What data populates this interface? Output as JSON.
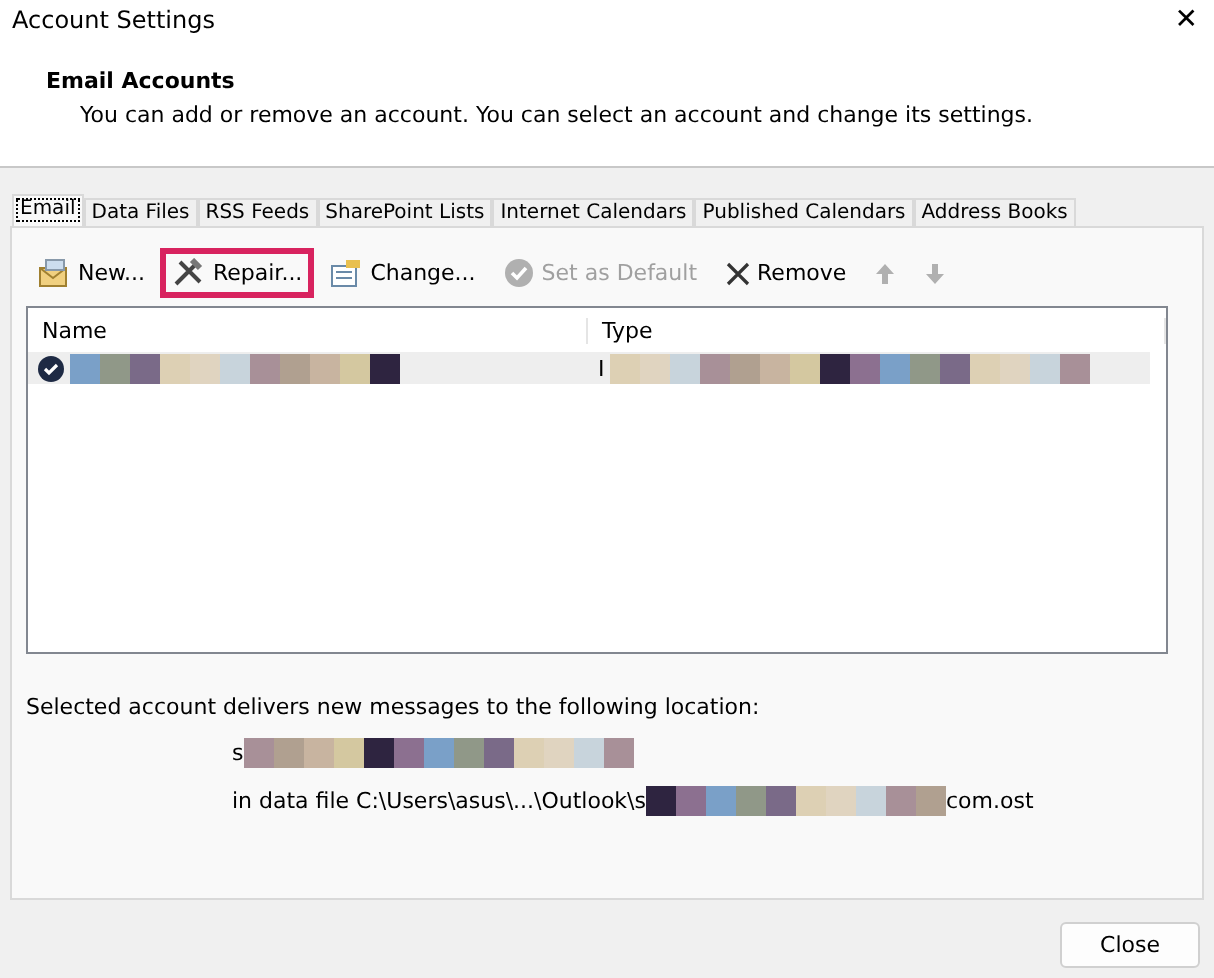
{
  "window": {
    "title": "Account Settings",
    "close_glyph": "✕"
  },
  "header": {
    "title": "Email Accounts",
    "description": "You can add or remove an account. You can select an account and change its settings."
  },
  "tabs": [
    {
      "label": "Email",
      "selected": true
    },
    {
      "label": "Data Files",
      "selected": false
    },
    {
      "label": "RSS Feeds",
      "selected": false
    },
    {
      "label": "SharePoint Lists",
      "selected": false
    },
    {
      "label": "Internet Calendars",
      "selected": false
    },
    {
      "label": "Published Calendars",
      "selected": false
    },
    {
      "label": "Address Books",
      "selected": false
    }
  ],
  "toolbar": [
    {
      "kind": "new",
      "label": "New...",
      "disabled": false,
      "highlighted": false
    },
    {
      "kind": "repair",
      "label": "Repair...",
      "disabled": false,
      "highlighted": true
    },
    {
      "kind": "change",
      "label": "Change...",
      "disabled": false,
      "highlighted": false
    },
    {
      "kind": "default",
      "label": "Set as Default",
      "disabled": true,
      "highlighted": false
    },
    {
      "kind": "remove",
      "label": "Remove",
      "disabled": false,
      "highlighted": false
    },
    {
      "kind": "up",
      "disabled": true,
      "highlighted": false
    },
    {
      "kind": "down",
      "disabled": true,
      "highlighted": false
    }
  ],
  "table": {
    "columns": [
      "Name",
      "Type"
    ],
    "rows": [
      {
        "selected": true,
        "is_default": true,
        "type_prefix": "I"
      }
    ]
  },
  "location": {
    "caption": "Selected account delivers new messages to the following location:",
    "account_prefix": "s",
    "file_prefix": "in data file C:\\Users\\asus\\...\\Outlook\\s",
    "file_suffix": "com.ost"
  },
  "buttons": [
    "Close"
  ]
}
